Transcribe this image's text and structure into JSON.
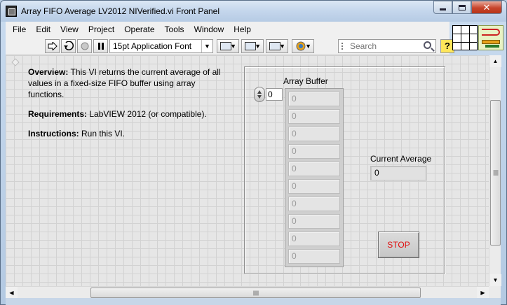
{
  "window": {
    "title": "Array FIFO Average LV2012 NIVerified.vi Front Panel",
    "close_glyph": "✕"
  },
  "menu": [
    "File",
    "Edit",
    "View",
    "Project",
    "Operate",
    "Tools",
    "Window",
    "Help"
  ],
  "toolbar": {
    "run_icon": "run-arrow-icon",
    "run_continuous_icon": "run-continuously-icon",
    "abort_icon": "abort-icon",
    "pause_icon": "pause-icon",
    "font": "15pt Application Font",
    "search_placeholder": "Search",
    "help": "?"
  },
  "overview": {
    "label": "Overview:",
    "text": " This VI returns the current average of all values in a fixed-size FIFO buffer using array functions.",
    "req_label": "Requirements:",
    "req_text": " LabVIEW 2012 (or compatible).",
    "instr_label": "Instructions:",
    "instr_text": " Run this VI."
  },
  "array_buffer": {
    "label": "Array Buffer",
    "index": "0",
    "elements": [
      "0",
      "0",
      "0",
      "0",
      "0",
      "0",
      "0",
      "0",
      "0",
      "0"
    ]
  },
  "current_average": {
    "label": "Current Average",
    "value": "0"
  },
  "stop_button": {
    "label": "STOP"
  },
  "colors": {
    "stop_text": "#e01010",
    "panel_bg": "#e6e6e6"
  }
}
